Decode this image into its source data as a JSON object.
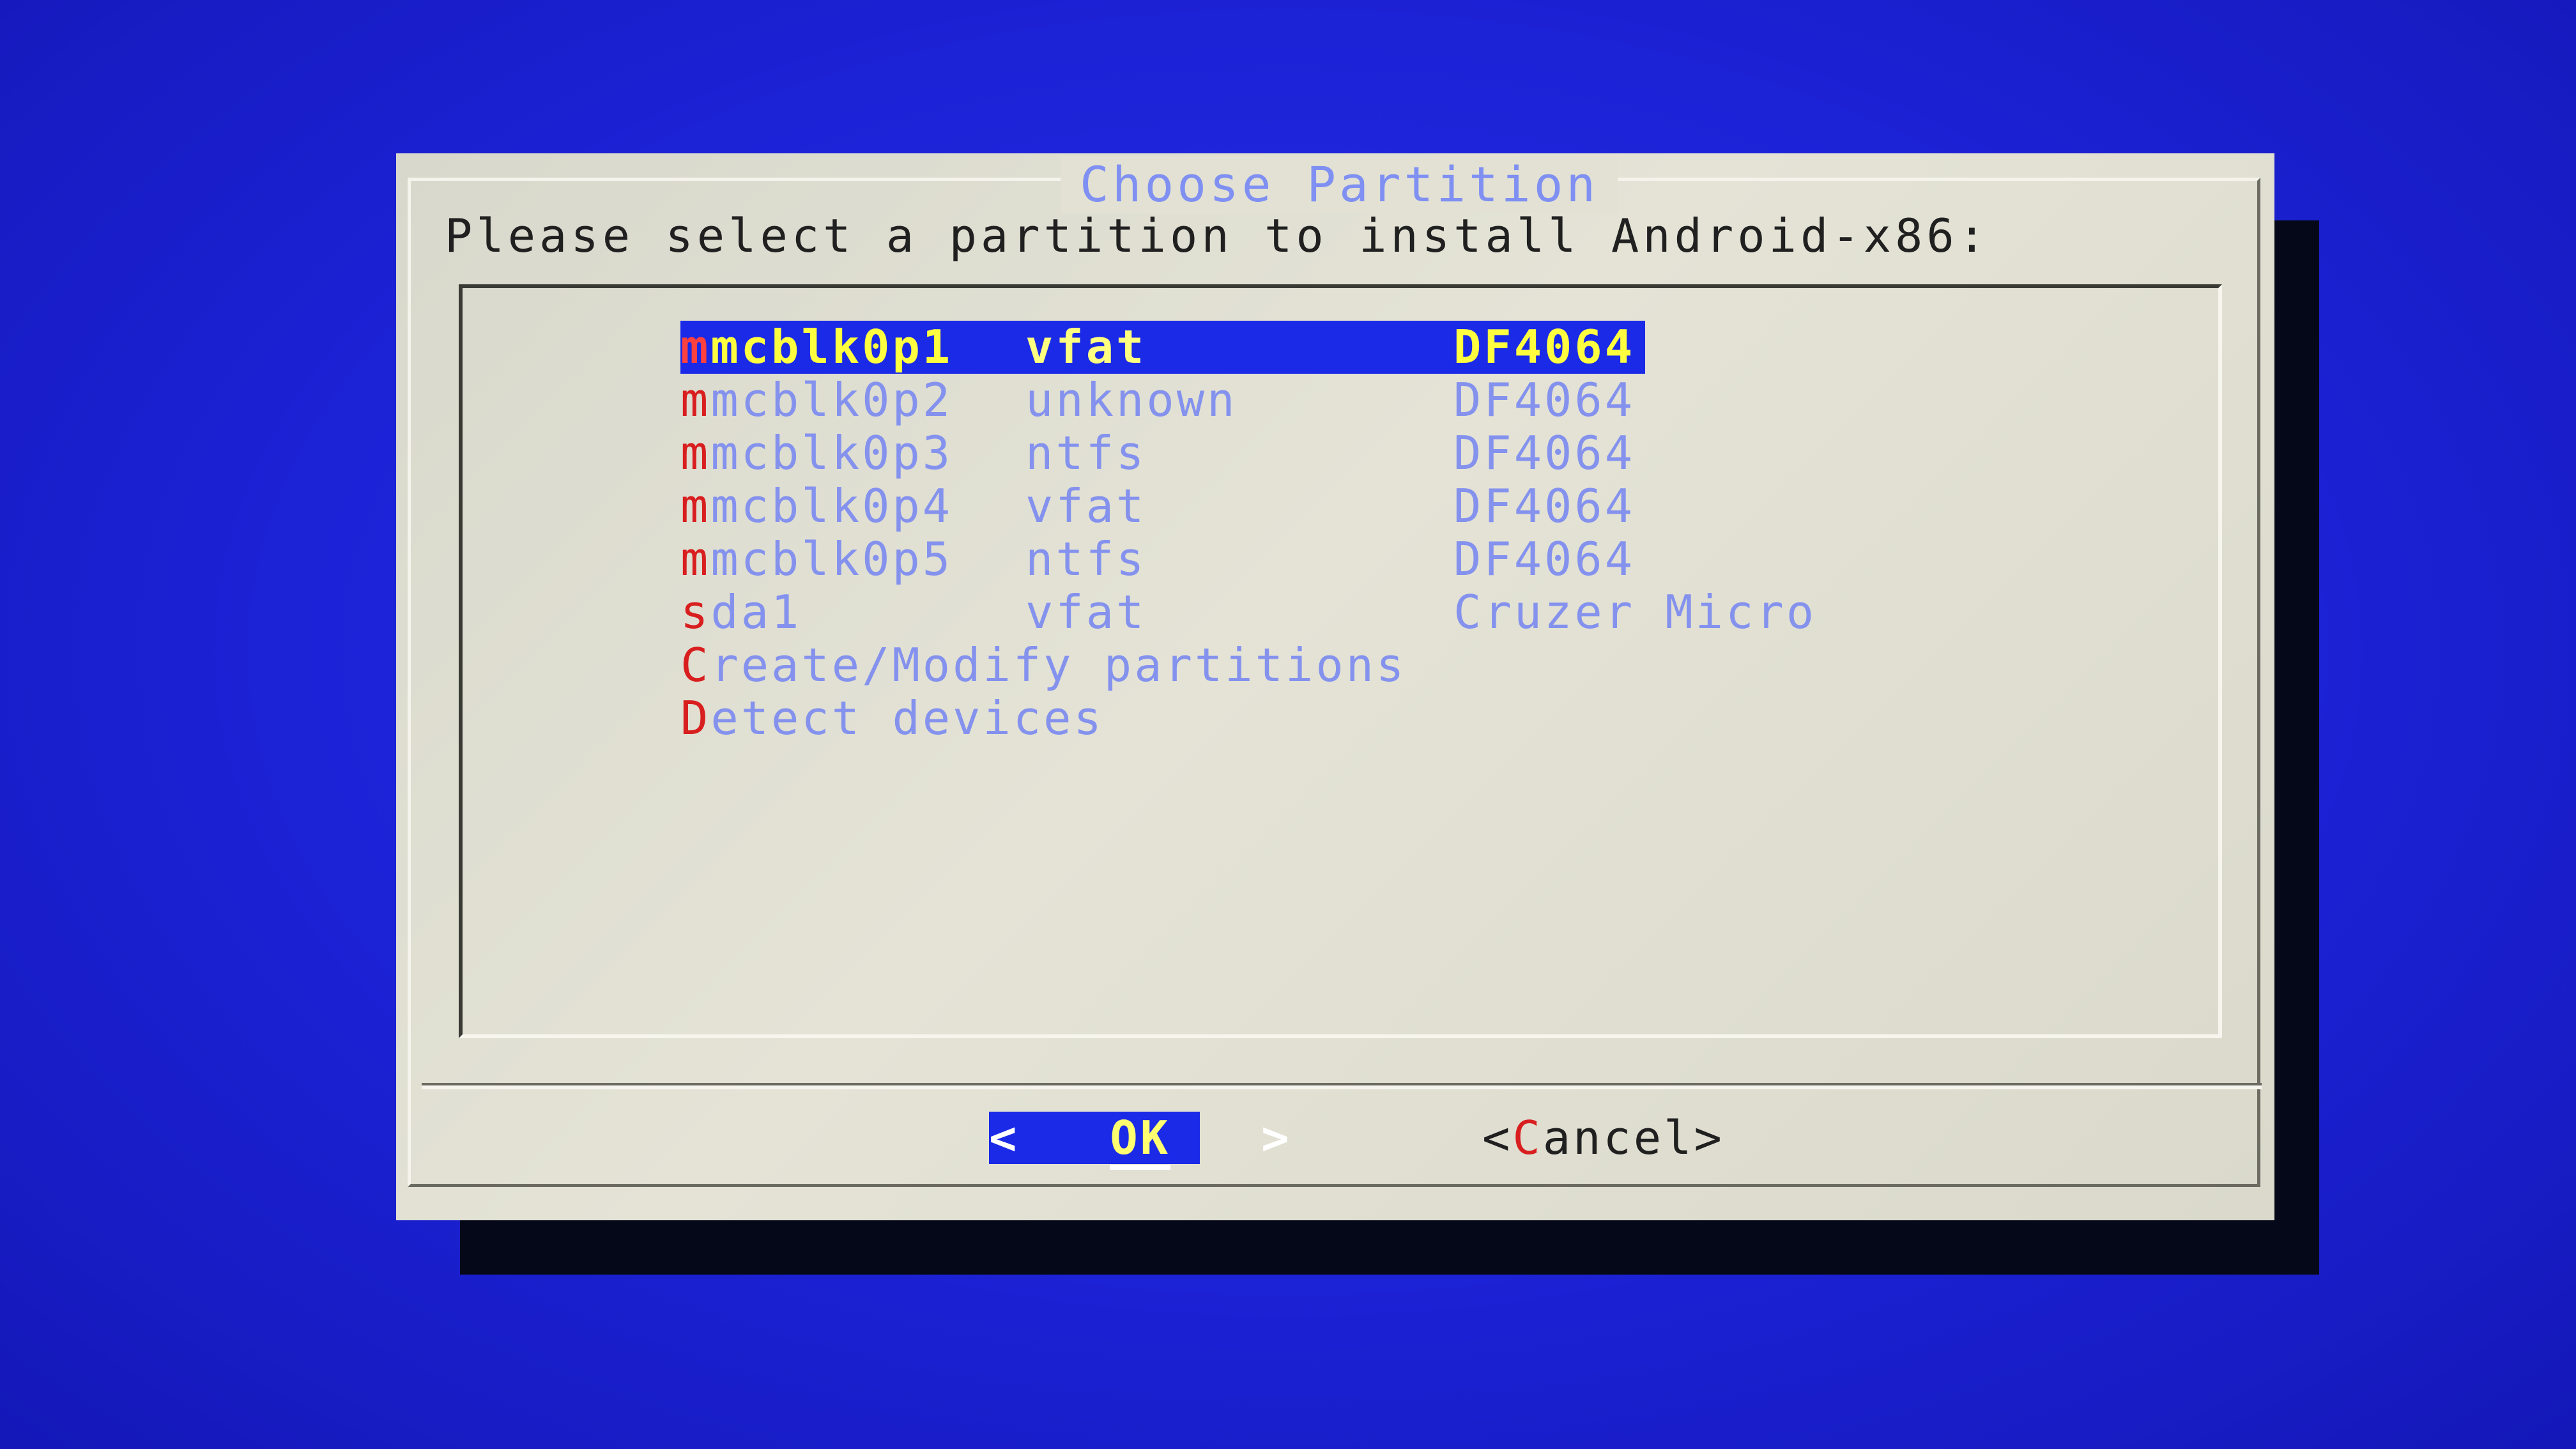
{
  "dialog": {
    "title": "Choose Partition",
    "prompt": "Please select a partition to install Android-x86:"
  },
  "partitions": [
    {
      "hotkey": "m",
      "rest": "mcblk0p1",
      "fs": "vfat",
      "label": "DF4064",
      "selected": true
    },
    {
      "hotkey": "m",
      "rest": "mcblk0p2",
      "fs": "unknown",
      "label": "DF4064",
      "selected": false
    },
    {
      "hotkey": "m",
      "rest": "mcblk0p3",
      "fs": "ntfs",
      "label": "DF4064",
      "selected": false
    },
    {
      "hotkey": "m",
      "rest": "mcblk0p4",
      "fs": "vfat",
      "label": "DF4064",
      "selected": false
    },
    {
      "hotkey": "m",
      "rest": "mcblk0p5",
      "fs": "ntfs",
      "label": "DF4064",
      "selected": false
    },
    {
      "hotkey": "s",
      "rest": "da1",
      "fs": "vfat",
      "label": "Cruzer Micro",
      "selected": false
    }
  ],
  "actions": [
    {
      "hotkey": "C",
      "rest": "reate/Modify partitions"
    },
    {
      "hotkey": "D",
      "rest": "etect devices"
    }
  ],
  "buttons": {
    "ok_left": "<",
    "ok_label": "OK",
    "ok_right": ">",
    "cancel_open": "<",
    "cancel_hotkey": "C",
    "cancel_rest": "ancel",
    "cancel_close": ">"
  },
  "colors": {
    "screen_bg": "#1a20d8",
    "dialog_bg": "#e2e1d4",
    "highlight": "#1a2ae6",
    "hotkey": "#d81e1e",
    "item_text": "#8492ee",
    "selected_text": "#ffff40"
  }
}
